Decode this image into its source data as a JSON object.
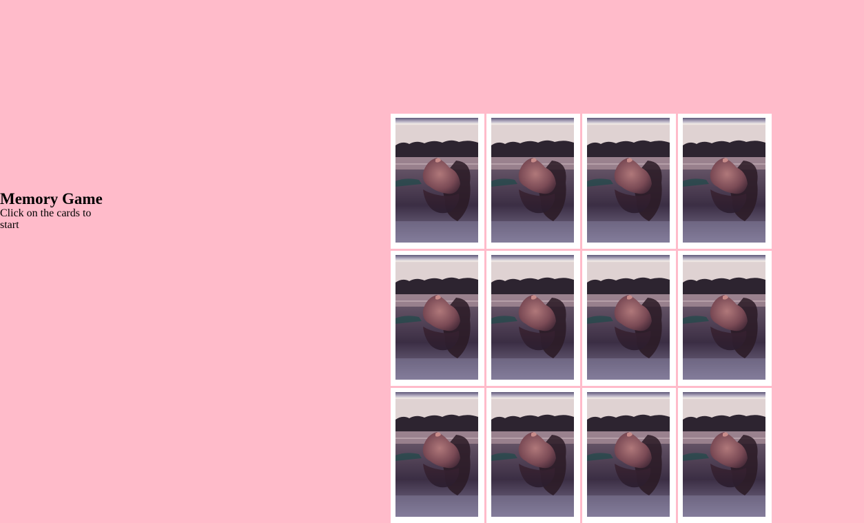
{
  "game": {
    "title": "Memory Game",
    "subtitle": "Click on the cards to start"
  },
  "colors": {
    "background": "#ffbbca",
    "card_border": "#ffffff"
  },
  "board": {
    "rows": 3,
    "columns": 4,
    "cards": [
      {
        "state": "face-down",
        "image": "card-back-photo-icon"
      },
      {
        "state": "face-down",
        "image": "card-back-photo-icon"
      },
      {
        "state": "face-down",
        "image": "card-back-photo-icon"
      },
      {
        "state": "face-down",
        "image": "card-back-photo-icon"
      },
      {
        "state": "face-down",
        "image": "card-back-photo-icon"
      },
      {
        "state": "face-down",
        "image": "card-back-photo-icon"
      },
      {
        "state": "face-down",
        "image": "card-back-photo-icon"
      },
      {
        "state": "face-down",
        "image": "card-back-photo-icon"
      },
      {
        "state": "face-down",
        "image": "card-back-photo-icon"
      },
      {
        "state": "face-down",
        "image": "card-back-photo-icon"
      },
      {
        "state": "face-down",
        "image": "card-back-photo-icon"
      },
      {
        "state": "face-down",
        "image": "card-back-photo-icon"
      }
    ]
  }
}
